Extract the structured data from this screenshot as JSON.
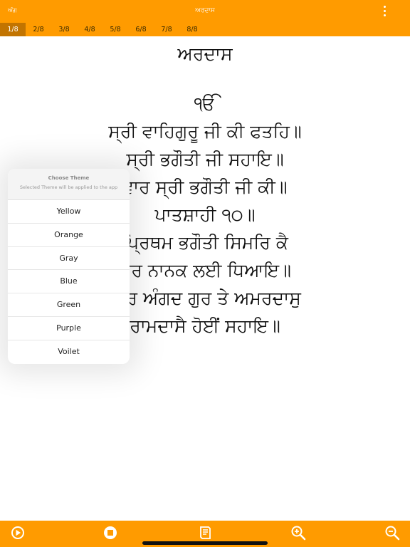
{
  "topbar": {
    "left_label": "ਅੰਗ",
    "title": "ਅਰਦਾਸ"
  },
  "pages": [
    "1/8",
    "2/8",
    "3/8",
    "4/8",
    "5/8",
    "6/8",
    "7/8",
    "8/8"
  ],
  "active_page": "1/8",
  "content": {
    "heading": "ਅਰਦਾਸ",
    "lines": [
      "ੴ",
      "ਸ੍ਰੀ ਵਾਹਿਗੁਰੂ ਜੀ ਕੀ ਫਤਹਿ॥",
      "ਸ੍ਰੀ ਭਗੌਤੀ ਜੀ ਸਹਾਇ॥",
      "ਵਾਰ ਸ੍ਰੀ ਭਗੌਤੀ ਜੀ ਕੀ॥",
      "ਪਾਤਸ਼ਾਹੀ ੧੦॥",
      "ਪ੍ਰਿਥਮ ਭਗੌਤੀ ਸਿਮਰਿ ਕੈ",
      "ਗੁਰ ਨਾਨਕ ਲਈ ਧਿਆਇ॥",
      "ਫਿਰ ਅੰਗਦ ਗੁਰ ਤੇ ਅਮਰਦਾਸੁ",
      "ਰਾਮਦਾਸੈ ਹੋਈਂ ਸਹਾਇ॥"
    ]
  },
  "theme_popover": {
    "title": "Choose Theme",
    "subtitle": "Selected Theme will be applied to the app",
    "options": [
      "Yellow",
      "Orange",
      "Gray",
      "Blue",
      "Green",
      "Purple",
      "Voilet"
    ]
  },
  "bottombar": {
    "icons": [
      "play-icon",
      "stop-icon",
      "book-icon",
      "zoom-in-icon",
      "zoom-out-icon"
    ]
  },
  "colors": {
    "accent": "#FF9B00",
    "active_tab": "#C27400"
  }
}
